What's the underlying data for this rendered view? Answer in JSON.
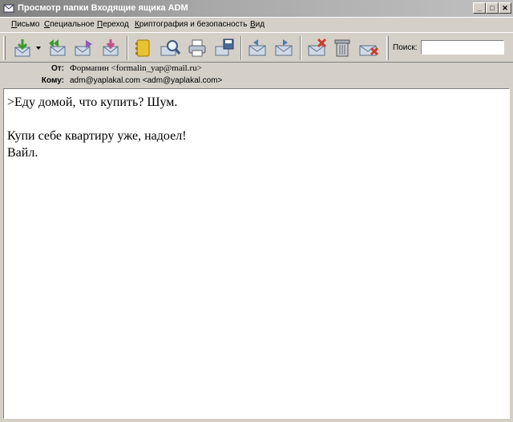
{
  "window": {
    "title": "Просмотр папки Входящие ящика ADM",
    "minimize_glyph": "_",
    "maximize_glyph": "□",
    "close_glyph": "✕"
  },
  "menu": [
    {
      "accel": "П",
      "rest": "исьмо"
    },
    {
      "accel": "С",
      "rest": "пециальное"
    },
    {
      "accel": "П",
      "rest": "ереход"
    },
    {
      "accel": "К",
      "rest": "риптография и безопасность"
    },
    {
      "accel": "В",
      "rest": "ид"
    }
  ],
  "toolbar": {
    "icons": [
      "get-mail-icon",
      "reply-all-icon",
      "forward-icon",
      "send-icon",
      "address-book-icon",
      "find-icon",
      "print-icon",
      "save-icon",
      "previous-icon",
      "next-icon",
      "delete-icon",
      "trash-icon",
      "not-spam-icon"
    ],
    "search_label": "Поиск:",
    "search_value": ""
  },
  "header": {
    "from_label": "От:",
    "from_value": "Формапин <formalin_yap@mail.ru>",
    "to_label": "Кому:",
    "to_value": "adm@yaplakal.com <adm@yaplakal.com>"
  },
  "message": {
    "lines": [
      ">Еду домой, что купить? Шум.",
      "",
      "Купи себе квартиру уже, надоел!",
      "Вайл."
    ]
  },
  "colors": {
    "window_bg": "#d4d0c8",
    "body_bg": "#ffffff"
  }
}
